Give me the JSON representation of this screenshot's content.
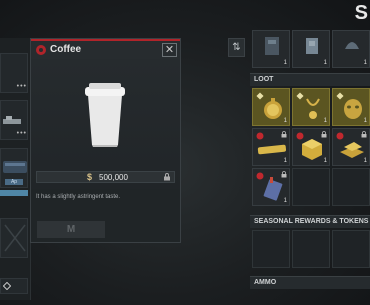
{
  "screen": {
    "corner_title": "S"
  },
  "popup": {
    "title": "Coffee",
    "description": "It has a slightly astringent taste.",
    "price_symbol": "$",
    "price": "500,000",
    "button_label": "M",
    "close_glyph": "✕",
    "item_icon": "coffee-cup-icon"
  },
  "left_panel": {
    "tag_label": "Ap"
  },
  "sort_button": {
    "glyph": "⇅"
  },
  "inventory": {
    "top_slots": [
      {
        "name": "tactical-rig-icon",
        "count": "1"
      },
      {
        "name": "body-armor-icon",
        "count": "1"
      },
      {
        "name": "helmet-icon",
        "count": "1"
      }
    ],
    "loot_header": "LOOT",
    "loot_slots": [
      {
        "name": "gold-pocket-watch-icon",
        "count": "1",
        "tier": "gold"
      },
      {
        "name": "gold-necklace-icon",
        "count": "1",
        "tier": "gold"
      },
      {
        "name": "gold-mask-icon",
        "count": "1",
        "tier": "gold"
      },
      {
        "name": "gold-bar-icon",
        "count": "1",
        "tier": "red"
      },
      {
        "name": "gold-cube-icon",
        "count": "1",
        "tier": "red"
      },
      {
        "name": "gold-ingots-icon",
        "count": "1",
        "tier": "red"
      },
      {
        "name": "keycard-icon",
        "count": "1",
        "tier": "red"
      }
    ],
    "seasonal_header": "SEASONAL REWARDS & TOKENS",
    "ammo_header": "AMMO"
  },
  "colors": {
    "accent_red": "#b0242a",
    "gold_slot": "#5b5521",
    "price_gold": "#d9c28a"
  }
}
